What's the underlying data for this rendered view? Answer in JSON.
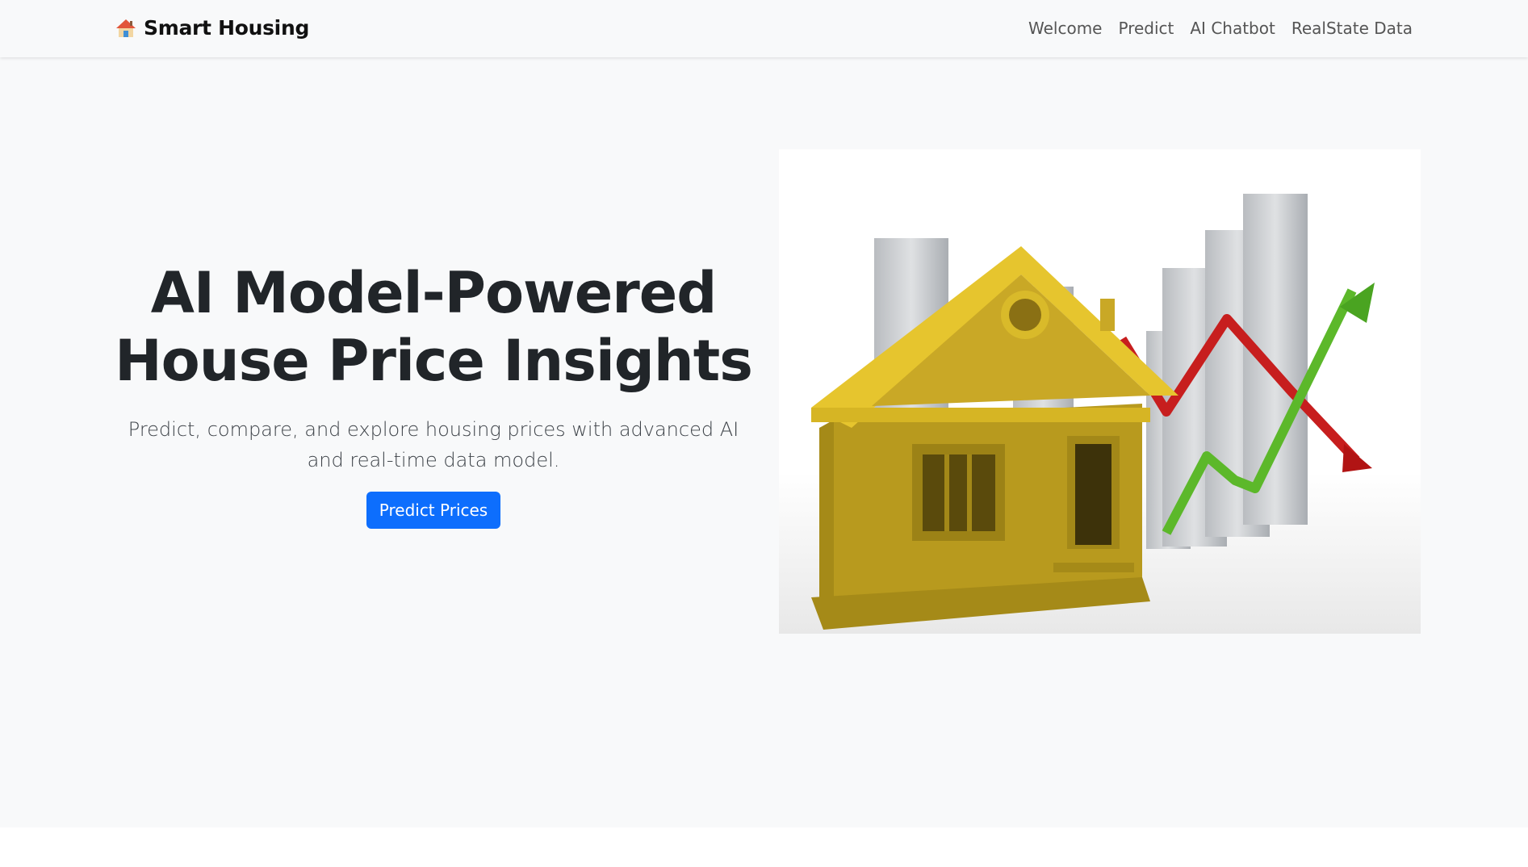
{
  "navbar": {
    "brand": {
      "icon": "house-icon",
      "label": "Smart Housing"
    },
    "links": [
      {
        "label": "Welcome"
      },
      {
        "label": "Predict"
      },
      {
        "label": "AI Chatbot"
      },
      {
        "label": "RealState Data"
      }
    ]
  },
  "hero": {
    "title_line1": "AI Model-Powered",
    "title_line2": "House Price Insights",
    "subtitle": "Predict, compare, and explore housing prices with advanced AI and real-time data model.",
    "cta_label": "Predict Prices",
    "image": {
      "subject": "house-with-bar-chart-and-trend-arrows"
    }
  },
  "colors": {
    "primary": "#0d6efd",
    "navbar_bg": "#f8f9fa",
    "text": "#212529",
    "house_gold": "#c9a826",
    "arrow_up": "#5cb82a",
    "arrow_down": "#c71e1e"
  }
}
